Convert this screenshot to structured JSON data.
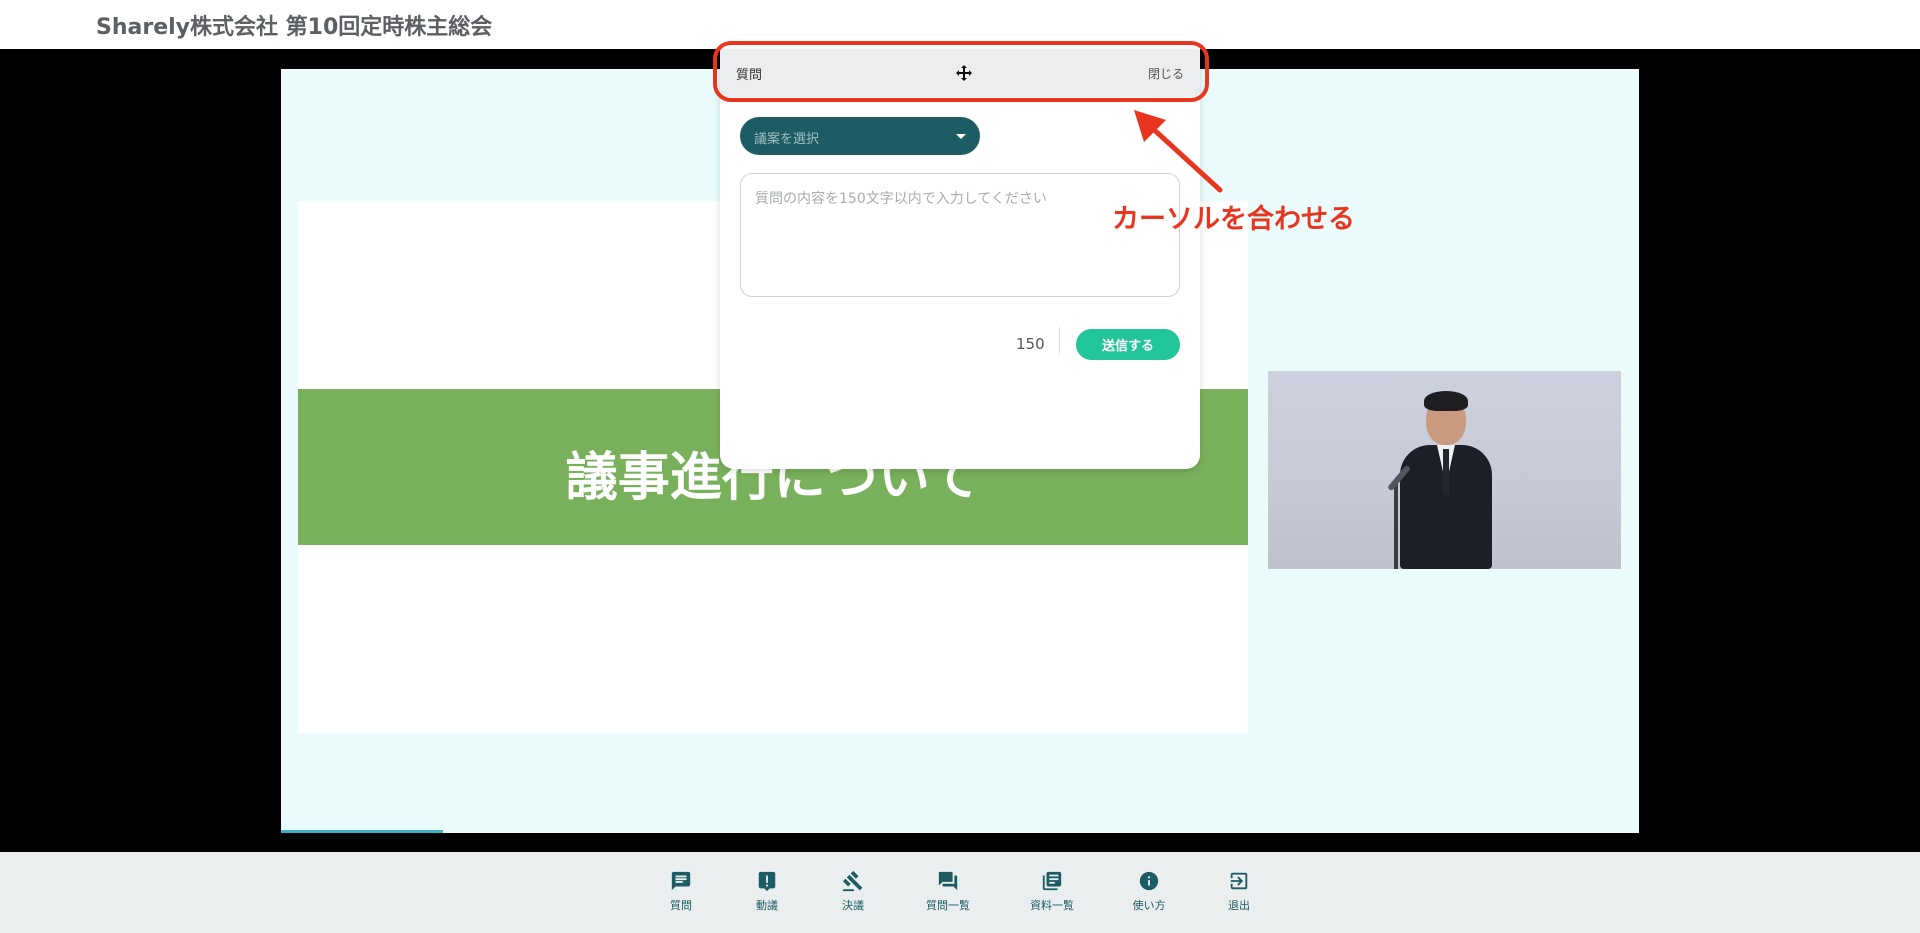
{
  "header": {
    "title": "Sharely株式会社 第10回定時株主総会"
  },
  "slide": {
    "title": "議事進行について"
  },
  "question_panel": {
    "title": "質問",
    "close_label": "閉じる",
    "agenda_select_placeholder": "議案を選択",
    "question_placeholder": "質問の内容を150文字以内で入力してください",
    "char_remaining": "150",
    "submit_label": "送信する"
  },
  "annotation": {
    "text": "カーソルを合わせる",
    "color": "#e8361e"
  },
  "toolbar": {
    "items": [
      {
        "label": "質問",
        "icon": "chat-bubble-icon"
      },
      {
        "label": "動議",
        "icon": "motion-alert-icon"
      },
      {
        "label": "決議",
        "icon": "gavel-icon"
      },
      {
        "label": "質問一覧",
        "icon": "forum-icon"
      },
      {
        "label": "資料一覧",
        "icon": "library-books-icon"
      },
      {
        "label": "使い方",
        "icon": "info-icon"
      },
      {
        "label": "退出",
        "icon": "logout-icon"
      }
    ]
  },
  "colors": {
    "accent": "#1d5c63",
    "send_button": "#22c49a",
    "slide_band": "#79b05b",
    "slide_background": "#e9fcfb"
  }
}
